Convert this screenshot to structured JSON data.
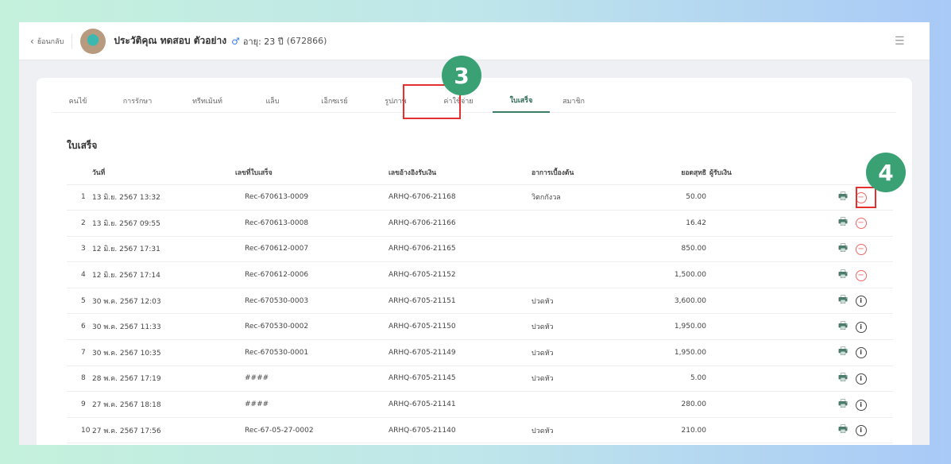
{
  "header": {
    "back_label": "ย้อนกลับ",
    "patient_name": "ประวัติคุณ ทดสอบ ตัวอย่าง",
    "gender_icon": "male-icon",
    "age": "อายุ: 23 ปี",
    "hn": "(672866)"
  },
  "tabs": [
    {
      "label": "คนไข้"
    },
    {
      "label": "การรักษา"
    },
    {
      "label": "ทรีทเม้นท์"
    },
    {
      "label": "แล็บ"
    },
    {
      "label": "เอ็กซเรย์"
    },
    {
      "label": "รูปภาพ"
    },
    {
      "label": "ค่าใช้จ่าย"
    },
    {
      "label": "ใบเสร็จ",
      "active": true
    },
    {
      "label": "สมาชิก"
    }
  ],
  "section_title": "ใบเสร็จ",
  "columns": {
    "date": "วันที่",
    "receipt_no": "เลขที่ใบเสร็จ",
    "ref": "เลขอ้างอิงรับเงิน",
    "symptom": "อาการเบื้องต้น",
    "net": "ยอดสุทธิ",
    "receiver": "ผู้รับเงิน"
  },
  "rows": [
    {
      "n": "1",
      "date": "13 มิ.ย. 2567 13:32",
      "no": "Rec-670613-0009",
      "ref": "ARHQ-6706-21168",
      "sym": "วิตกกังวล",
      "net": "50.00",
      "action": "cancel"
    },
    {
      "n": "2",
      "date": "13 มิ.ย. 2567 09:55",
      "no": "Rec-670613-0008",
      "ref": "ARHQ-6706-21166",
      "sym": "",
      "net": "16.42",
      "action": "cancel"
    },
    {
      "n": "3",
      "date": "12 มิ.ย. 2567 17:31",
      "no": "Rec-670612-0007",
      "ref": "ARHQ-6706-21165",
      "sym": "",
      "net": "850.00",
      "action": "cancel"
    },
    {
      "n": "4",
      "date": "12 มิ.ย. 2567 17:14",
      "no": "Rec-670612-0006",
      "ref": "ARHQ-6705-21152",
      "sym": "",
      "net": "1,500.00",
      "action": "cancel"
    },
    {
      "n": "5",
      "date": "30 พ.ค. 2567 12:03",
      "no": "Rec-670530-0003",
      "ref": "ARHQ-6705-21151",
      "sym": "ปวดหัว",
      "net": "3,600.00",
      "action": "info"
    },
    {
      "n": "6",
      "date": "30 พ.ค. 2567 11:33",
      "no": "Rec-670530-0002",
      "ref": "ARHQ-6705-21150",
      "sym": "ปวดหัว",
      "net": "1,950.00",
      "action": "info"
    },
    {
      "n": "7",
      "date": "30 พ.ค. 2567 10:35",
      "no": "Rec-670530-0001",
      "ref": "ARHQ-6705-21149",
      "sym": "ปวดหัว",
      "net": "1,950.00",
      "action": "info"
    },
    {
      "n": "8",
      "date": "28 พ.ค. 2567 17:19",
      "no": "####",
      "ref": "ARHQ-6705-21145",
      "sym": "ปวดหัว",
      "net": "5.00",
      "action": "info"
    },
    {
      "n": "9",
      "date": "27 พ.ค. 2567 18:18",
      "no": "####",
      "ref": "ARHQ-6705-21141",
      "sym": "",
      "net": "280.00",
      "action": "info"
    },
    {
      "n": "10",
      "date": "27 พ.ค. 2567 17:56",
      "no": "Rec-67-05-27-0002",
      "ref": "ARHQ-6705-21140",
      "sym": "ปวดหัว",
      "net": "210.00",
      "action": "info"
    }
  ],
  "annotations": {
    "step3": "3",
    "step4": "4"
  },
  "colors": {
    "accent": "#3a7f63",
    "badge": "#3aa174",
    "highlight": "#e53030"
  }
}
